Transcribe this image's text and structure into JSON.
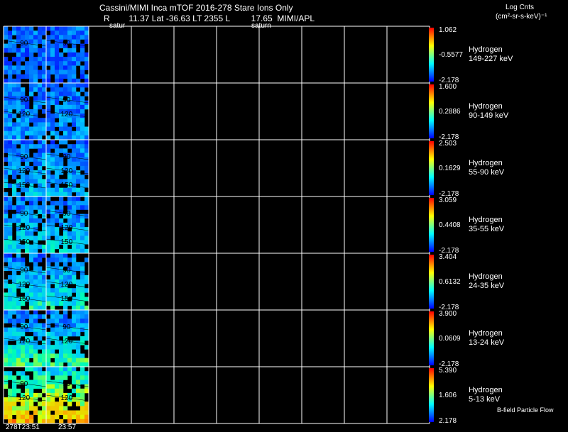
{
  "header": {
    "title": "Cassini/MIMI Inca mTOF  2016-278   Stare   Ions Only",
    "subtitle": "R        11.37 Lat -36.63 LT 2355 L         17.65  MIMI/APL",
    "label_saturn_1": "satur",
    "label_saturn_2": "saturn",
    "units_title": "Log Cnts",
    "units_sub": "(cm²-sr-s-keV)⁻¹"
  },
  "footer": {
    "time_1": "278T23:51",
    "time_2": "23:57",
    "note": "B-field Particle Flow"
  },
  "chart_data": {
    "type": "heatmap",
    "title": "Cassini/MIMI Inca mTOF  2016-278   Stare   Ions Only",
    "x_tick_labels": [
      "278T23:51",
      "23:57"
    ],
    "colormap": [
      "#0000ff",
      "#00ffff",
      "#ffff00",
      "#ff0000"
    ],
    "panels": [
      {
        "species": "Hydrogen",
        "energy": "149-227 keV",
        "max": "1.062",
        "mid": "-0.5577",
        "min": "-2.178",
        "contours": [
          "90"
        ]
      },
      {
        "species": "Hydrogen",
        "energy": "90-149 keV",
        "max": "1.600",
        "mid": "0.2886",
        "min": "-2.178",
        "contours": [
          "90",
          "120"
        ]
      },
      {
        "species": "Hydrogen",
        "energy": "55-90 keV",
        "max": "2.503",
        "mid": "0.1629",
        "min": "-2.178",
        "contours": [
          "90",
          "120",
          "150"
        ]
      },
      {
        "species": "Hydrogen",
        "energy": "35-55 keV",
        "max": "3.059",
        "mid": "0.4408",
        "min": "-2.178",
        "contours": [
          "90",
          "120",
          "150"
        ]
      },
      {
        "species": "Hydrogen",
        "energy": "24-35 keV",
        "max": "3.404",
        "mid": "0.6132",
        "min": "-2.178",
        "contours": [
          "90",
          "120",
          "150"
        ]
      },
      {
        "species": "Hydrogen",
        "energy": "13-24 keV",
        "max": "3.900",
        "mid": "0.0609",
        "min": "-2.178",
        "contours": [
          "90",
          "120"
        ]
      },
      {
        "species": "Hydrogen",
        "energy": "5-13 keV",
        "max": "5.390",
        "mid": "1.606",
        "min": "2.178",
        "contours": [
          "90",
          "120"
        ]
      }
    ],
    "images_per_row": 2,
    "empty_columns": 8,
    "grid": true
  }
}
